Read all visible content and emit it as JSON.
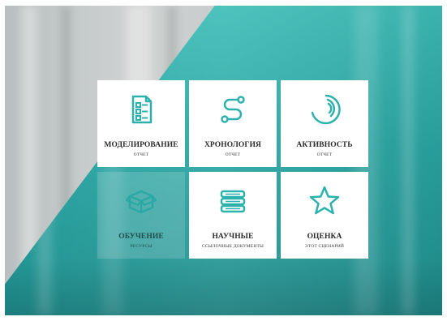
{
  "colors": {
    "accent": "#2bb2ad",
    "tile_bg": "#ffffff",
    "text": "#2a2a2a"
  },
  "tiles": [
    {
      "title": "МОДЕЛИРОВАНИЕ",
      "subtitle": "ОТЧЕТ",
      "icon": "checklist-document-icon"
    },
    {
      "title": "ХРОНОЛОГИЯ",
      "subtitle": "ОТЧЕТ",
      "icon": "timeline-path-icon"
    },
    {
      "title": "АКТИВНОСТЬ",
      "subtitle": "ОТЧЕТ",
      "icon": "activity-arcs-icon"
    },
    {
      "title": "ОБУЧЕНИЕ",
      "subtitle": "РЕСУРСЫ",
      "icon": "box-icon"
    },
    {
      "title": "НАУЧНЫЕ",
      "subtitle": "ССЫЛОЧНЫЕ ДОКУМЕНТЫ",
      "icon": "books-icon"
    },
    {
      "title": "ОЦЕНКА",
      "subtitle": "ЭТОТ СЦЕНАРИЙ",
      "icon": "star-icon"
    }
  ]
}
